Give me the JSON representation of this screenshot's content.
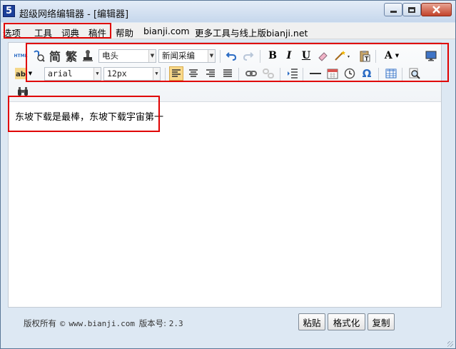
{
  "window": {
    "title": "超级网络编辑器 - [编辑器]",
    "ghost_title": "..."
  },
  "menu": [
    "选项",
    "工具",
    "词典",
    "稿件",
    "帮助",
    "bianji.com",
    "更多工具与线上版bianji.net"
  ],
  "toolbar": {
    "row1": {
      "html_label": "HTML",
      "simplified_label": "简",
      "traditional_label": "繁",
      "font_style_select": "电头",
      "template_select": "新闻采编",
      "text_color_label": "A"
    },
    "row2": {
      "font_family_select": "arial",
      "font_size_select": "12px",
      "omega_label": "Ω"
    }
  },
  "content": {
    "text": "东坡下载是最棒，东坡下载宇宙第一"
  },
  "footer": {
    "copyright_prefix": "版权所有",
    "copyright_symbol": "©",
    "site": "www.bianji.com",
    "version_label": "版本号:",
    "version": "2.3",
    "buttons": [
      "粘贴",
      "格式化",
      "复制"
    ]
  },
  "colors": {
    "highlight_box": "#e00000",
    "accent_blue": "#2b6cc4"
  }
}
